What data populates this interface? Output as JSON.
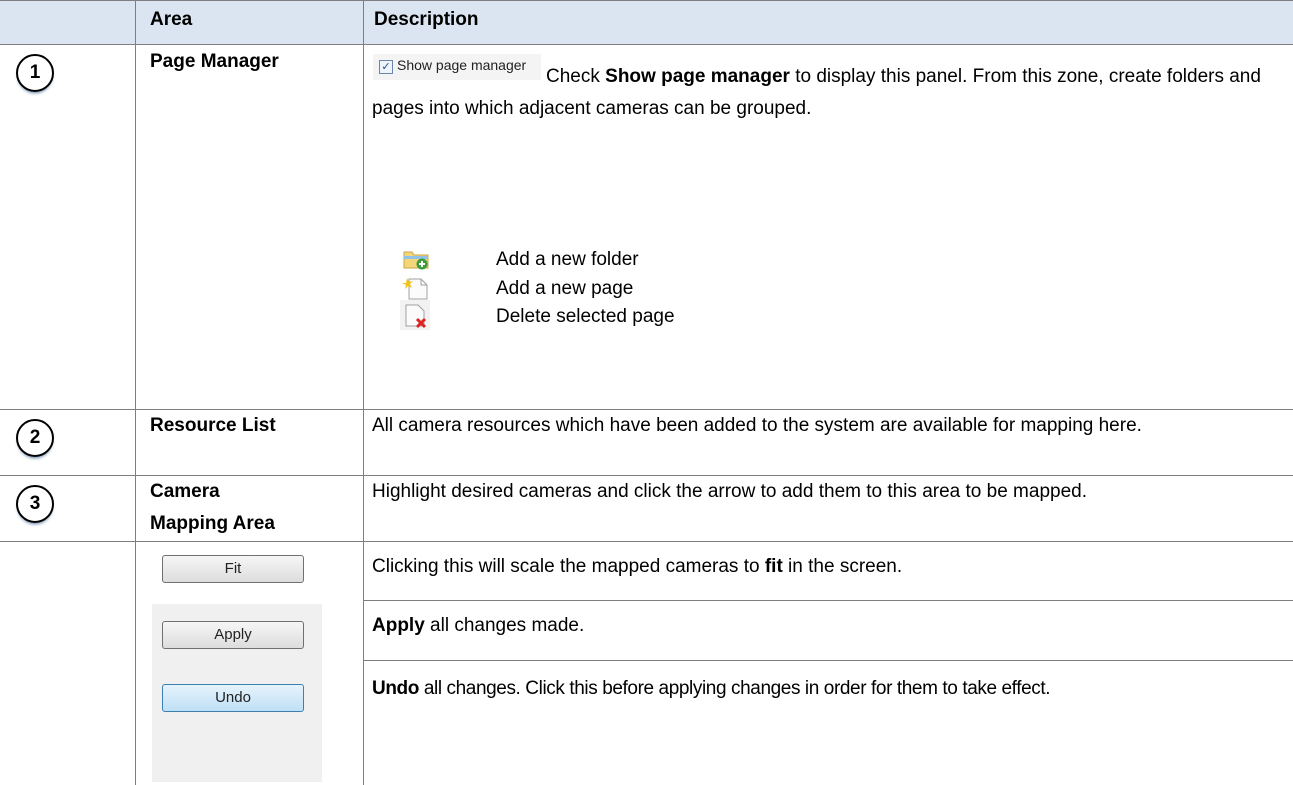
{
  "header": {
    "area_label": "Area",
    "description_label": "Description"
  },
  "rows": [
    {
      "number": "1",
      "area": "Page Manager",
      "checkbox_label": "Show page manager",
      "desc_pre": "Check ",
      "desc_bold": "Show page manager",
      "desc_post": " to display this panel. From this zone, create folders and pages into which adjacent cameras can be grouped.",
      "icons": [
        {
          "icon": "folder-add-icon",
          "label": "Add a new folder"
        },
        {
          "icon": "new-page-icon",
          "label": "Add a new page"
        },
        {
          "icon": "delete-page-icon",
          "label": "Delete selected page"
        }
      ]
    },
    {
      "number": "2",
      "area": "Resource List",
      "description": "All camera resources which have been added to the system are available for mapping here."
    },
    {
      "number": "3",
      "area_line1": "Camera",
      "area_line2": "Mapping Area",
      "description": "Highlight desired cameras and click the arrow to add them to this area to be mapped."
    }
  ],
  "buttons": [
    {
      "label": "Fit",
      "desc_pre": "Clicking this will scale the mapped cameras to ",
      "desc_bold": "fit",
      "desc_post": " in the screen."
    },
    {
      "label": "Apply",
      "desc_bold": "Apply",
      "desc_post": " all changes made."
    },
    {
      "label": "Undo",
      "desc_bold": "Undo",
      "desc_post": " all changes. Click this before applying changes in order for them to take effect."
    }
  ],
  "colors": {
    "header_bg": "#dbe5f1",
    "border": "#7f7f7f",
    "undo_button": "#bfe0f6"
  }
}
